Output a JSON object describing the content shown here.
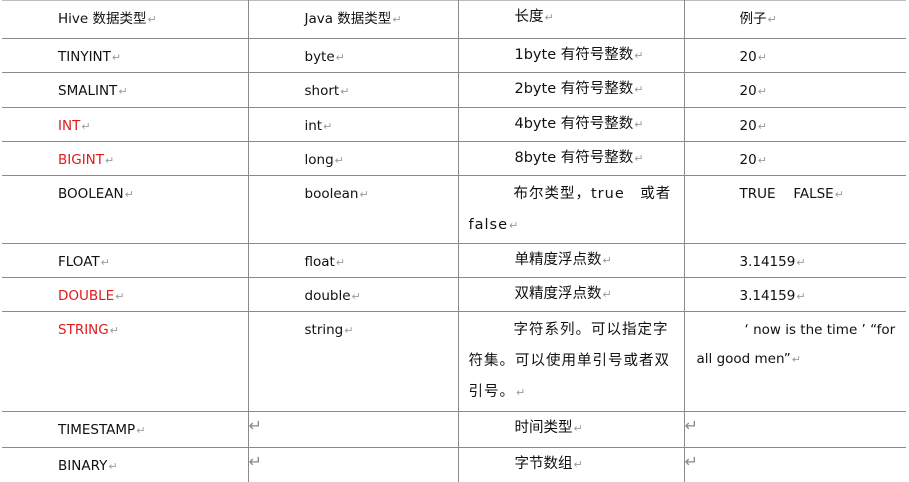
{
  "header": {
    "col1": "Hive 数据类型",
    "col2": "Java 数据类型",
    "col3": "长度",
    "col4": "例子"
  },
  "paragraph_mark": "↵",
  "empty_cell_mark": "↵",
  "rows": [
    {
      "hive": "TINYINT",
      "java": "byte",
      "length": "1byte 有符号整数",
      "example": "20"
    },
    {
      "hive": "SMALINT",
      "java": "short",
      "length": "2byte 有符号整数",
      "example": "20"
    },
    {
      "hive": "INT",
      "java": "int",
      "length": "4byte 有符号整数",
      "example": "20"
    },
    {
      "hive": "BIGINT",
      "java": "long",
      "length": "8byte 有符号整数",
      "example": "20"
    },
    {
      "hive": "BOOLEAN",
      "java": "boolean",
      "length": "布尔类型，true　或者 false",
      "example": "TRUE　 FALSE"
    },
    {
      "hive": "FLOAT",
      "java": "float",
      "length": "单精度浮点数",
      "example": "3.14159"
    },
    {
      "hive": "DOUBLE",
      "java": "double",
      "length": "双精度浮点数",
      "example": "3.14159"
    },
    {
      "hive": "STRING",
      "java": "string",
      "length": "字符系列。可以指定字符集。可以使用单引号或者双引号。",
      "example": "‘ now is the time ’ “for all good men”"
    },
    {
      "hive": "TIMESTAMP",
      "java": "",
      "length": "时间类型",
      "example": ""
    },
    {
      "hive": "BINARY",
      "java": "",
      "length": "字节数组",
      "example": ""
    }
  ],
  "colors": {
    "highlight": "#e01b1b",
    "text": "#111111",
    "border": "#8a8a8a"
  }
}
